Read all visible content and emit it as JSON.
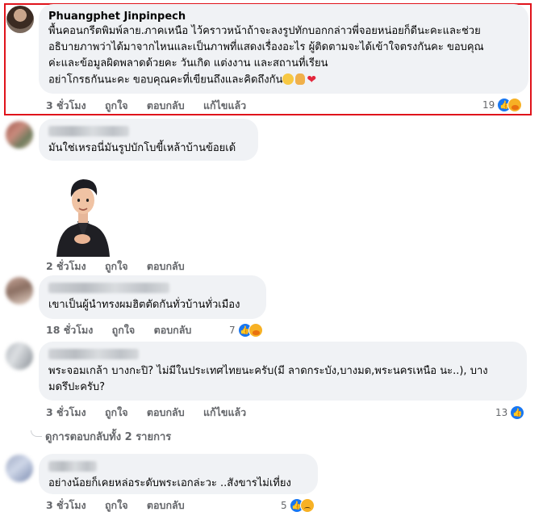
{
  "comments": [
    {
      "author": "Phuangphet Jinpinpech",
      "text": "พื้นคอนกรีตพิมพ์ลาย.ภาคเหนือ ไว้คราวหน้าถ้าจะลงรูปทักบอกกล่าวพี่จอยหน่อยก็ดีนะคะและช่วย\nอธิบายภาพว่าได้มาจากไหนและเป็นภาพที่แสดงเรื่องอะไร ผู้ติดตามจะได้เข้าใจตรงกันคะ ขอบคุณ\nค่ะและข้อมูลผิดพลาดด้วยคะ วันเกิด แต่งงาน และสถานที่เรียน\nอย่าโกรธกันนะคะ ขอบคุณคะที่เขียนถึงและคิดถึงกัน",
      "time": "3 ชั่วโมง",
      "like": "ถูกใจ",
      "reply": "ตอบกลับ",
      "edited": "แก้ไขแล้ว",
      "reaction_count": "19",
      "reaction_icons": [
        "like-icon",
        "care-icon"
      ],
      "trailing_emojis": [
        "smiling-face-emoji",
        "strong-arm-emoji",
        "red-heart-emoji"
      ],
      "highlighted": true,
      "highlight_color": "#e0131b"
    },
    {
      "author": "",
      "text": "มันใช่เหรอนี่มันรูปบักโบขี้เหล้าบ้านข้อยเด้",
      "time": "2 ชั่วโมง",
      "like": "ถูกใจ",
      "reply": "ตอบกลับ",
      "has_sticker": true,
      "sticker_icon": "cartoon-man-hand-on-chest-sticker"
    },
    {
      "author": "",
      "text": "เขาเป็นผู้นำทรงผมฮิตตัดกันทั่วบ้านทั่วเมือง",
      "time": "18 ชั่วโมง",
      "like": "ถูกใจ",
      "reply": "ตอบกลับ",
      "reaction_count": "7",
      "reaction_icons": [
        "like-icon",
        "care-icon"
      ]
    },
    {
      "author": "",
      "text": "พระจอมเกล้า บางกะปิ? ไม่มีในประเทศไทยนะครับ(มี ลาดกระบัง,บางมด,พระนครเหนือ นะ..), บาง\nมดรึปะครับ?",
      "time": "3 ชั่วโมง",
      "like": "ถูกใจ",
      "reply": "ตอบกลับ",
      "edited": "แก้ไขแล้ว",
      "reaction_count": "13",
      "reaction_icons": [
        "like-icon"
      ]
    },
    {
      "author": "",
      "text": "อย่างน้อยก็เคยหล่อระดับพระเอกล่ะวะ ..สังขารไม่เที่ยง",
      "time": "3 ชั่วโมง",
      "like": "ถูกใจ",
      "reply": "ตอบกลับ",
      "reaction_count": "5",
      "reaction_icons": [
        "like-icon",
        "sad-icon"
      ]
    }
  ],
  "view_replies": "ดูการตอบกลับทั้ง 2 รายการ",
  "colors": {
    "bubble": "#f0f2f5",
    "meta_text": "#65676b",
    "like_blue": "#1877f2"
  }
}
